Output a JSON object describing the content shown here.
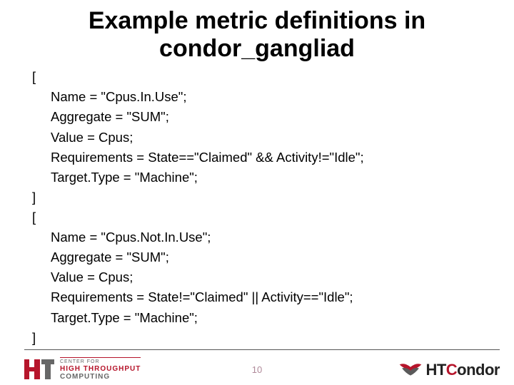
{
  "title": "Example metric definitions in condor_gangliad",
  "blocks": [
    {
      "open": "[",
      "lines": [
        "Name   = \"Cpus.In.Use\";",
        "Aggregate = \"SUM\";",
        "Value  = Cpus;",
        "Requirements = State==\"Claimed\" && Activity!=\"Idle\";",
        "Target.Type = \"Machine\";"
      ],
      "close": "]"
    },
    {
      "open": "[",
      "lines": [
        "Name   = \"Cpus.Not.In.Use\";",
        "Aggregate = \"SUM\";",
        "Value  = Cpus;",
        "Requirements = State!=\"Claimed\" || Activity==\"Idle\";",
        "Target.Type = \"Machine\";"
      ],
      "close": "]"
    }
  ],
  "page_number": "10",
  "footer_left": {
    "line1": "CENTER FOR",
    "line2": "HIGH THROUGHPUT",
    "line3": "COMPUTING"
  },
  "footer_right": {
    "ht": "HT",
    "c": "C",
    "ondor": "ondor"
  }
}
